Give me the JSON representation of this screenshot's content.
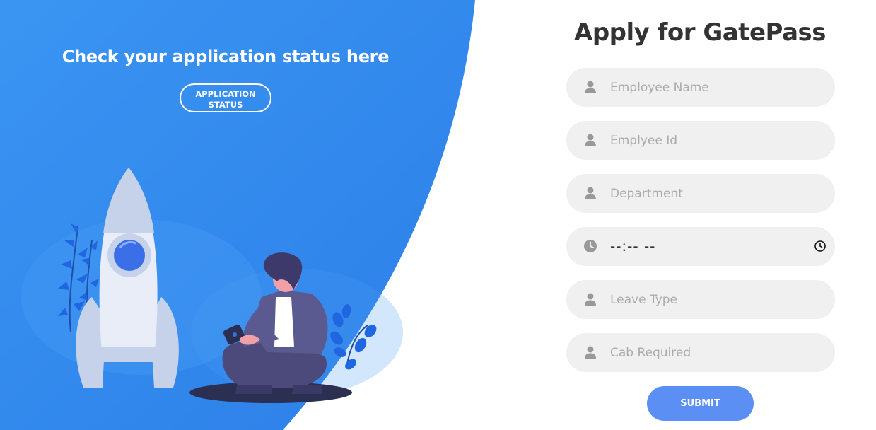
{
  "left_panel": {
    "heading": "Check your application status here",
    "status_button": "APPLICATION STATUS"
  },
  "form": {
    "title": "Apply for GatePass",
    "fields": [
      {
        "placeholder": "Employee Name",
        "icon": "user-icon"
      },
      {
        "placeholder": "Emplyee Id",
        "icon": "user-icon"
      },
      {
        "placeholder": "Department",
        "icon": "user-icon"
      },
      {
        "value": "--:-- --",
        "icon": "clock-icon",
        "picker_icon": "clock-icon"
      },
      {
        "placeholder": "Leave Type",
        "icon": "user-icon"
      },
      {
        "placeholder": "Cab Required",
        "icon": "user-icon"
      }
    ],
    "submit_label": "SUBMIT"
  },
  "colors": {
    "accent_blue": "#3a8ef0",
    "submit_blue": "#5b8ff3",
    "field_bg": "#f0f0f0",
    "placeholder": "#aaaaaa",
    "title": "#333333"
  }
}
